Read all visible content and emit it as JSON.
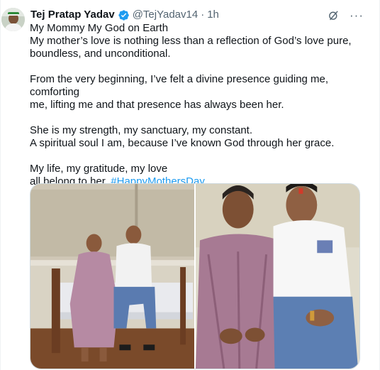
{
  "tweet": {
    "author": {
      "display_name": "Tej Pratap Yadav",
      "handle": "@TejYadav14",
      "separator": "·",
      "time": "1h",
      "verified": true,
      "verified_color": "#1d9bf0"
    },
    "icons": {
      "avatar": "profile-avatar",
      "verified": "verified-badge-icon",
      "grok": "grok-icon",
      "more": "more-icon"
    },
    "more_label": "···",
    "lines": [
      "My Mommy My God on Earth",
      "My mother’s love is nothing less than a reflection of God’s love pure,",
      "boundless, and unconditional.",
      "",
      "From the very beginning, I’ve felt a divine presence guiding me, comforting",
      "me, lifting me and that presence has always been her.",
      "",
      "She is my strength, my sanctuary, my constant.",
      "A spiritual soul I am, because I’ve known God through her grace.",
      "",
      "My life, my gratitude, my love"
    ],
    "last_line_text": "all belong to her.",
    "hashtag": "#HappyMothersDay",
    "hashtag_color": "#1d9bf0",
    "media": [
      {
        "type": "photo"
      },
      {
        "type": "photo"
      }
    ]
  }
}
